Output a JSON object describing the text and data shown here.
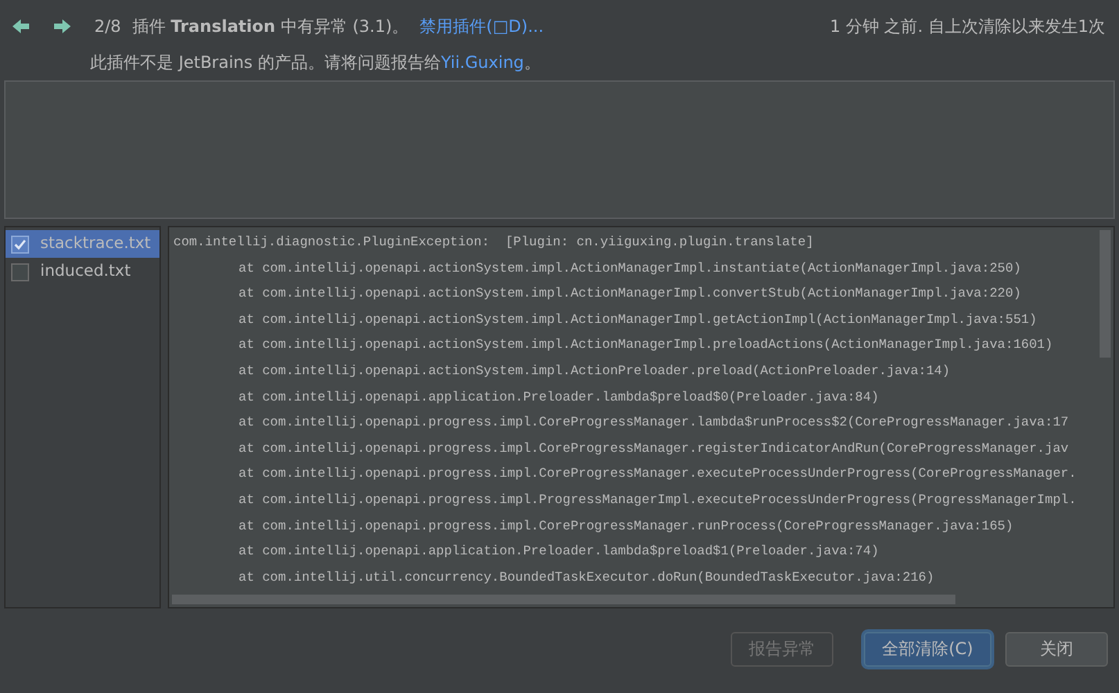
{
  "header": {
    "counter": "2/8",
    "message": "插件 **Translation** 中有异常 (3.1)。",
    "disable_link": "禁用插件(□D)...",
    "time": "1 分钟 之前. 自上次清除以来发生1次",
    "note": "此插件不是 JetBrains 的产品。请将问题报告给",
    "author_link": "Yii.Guxing",
    "note_end": "。"
  },
  "attachments": [
    {
      "name": "stacktrace.txt",
      "checked": true,
      "selected": true
    },
    {
      "name": "induced.txt",
      "checked": false,
      "selected": false
    }
  ],
  "stack_trace": [
    {
      "kind": "exception",
      "text": "com.intellij.diagnostic.PluginException:  [Plugin: cn.yiiguxing.plugin.translate]"
    },
    {
      "kind": "frame",
      "text": "at com.intellij.openapi.actionSystem.impl.ActionManagerImpl.instantiate(ActionManagerImpl.java:250)"
    },
    {
      "kind": "frame",
      "text": "at com.intellij.openapi.actionSystem.impl.ActionManagerImpl.convertStub(ActionManagerImpl.java:220)"
    },
    {
      "kind": "frame",
      "text": "at com.intellij.openapi.actionSystem.impl.ActionManagerImpl.getActionImpl(ActionManagerImpl.java:551)"
    },
    {
      "kind": "frame",
      "text": "at com.intellij.openapi.actionSystem.impl.ActionManagerImpl.preloadActions(ActionManagerImpl.java:1601)"
    },
    {
      "kind": "frame",
      "text": "at com.intellij.openapi.actionSystem.impl.ActionPreloader.preload(ActionPreloader.java:14)"
    },
    {
      "kind": "frame",
      "text": "at com.intellij.openapi.application.Preloader.lambda$preload$0(Preloader.java:84)"
    },
    {
      "kind": "frame",
      "text": "at com.intellij.openapi.progress.impl.CoreProgressManager.lambda$runProcess$2(CoreProgressManager.java:17"
    },
    {
      "kind": "frame",
      "text": "at com.intellij.openapi.progress.impl.CoreProgressManager.registerIndicatorAndRun(CoreProgressManager.jav"
    },
    {
      "kind": "frame",
      "text": "at com.intellij.openapi.progress.impl.CoreProgressManager.executeProcessUnderProgress(CoreProgressManager."
    },
    {
      "kind": "frame",
      "text": "at com.intellij.openapi.progress.impl.ProgressManagerImpl.executeProcessUnderProgress(ProgressManagerImpl."
    },
    {
      "kind": "frame",
      "text": "at com.intellij.openapi.progress.impl.CoreProgressManager.runProcess(CoreProgressManager.java:165)"
    },
    {
      "kind": "frame",
      "text": "at com.intellij.openapi.application.Preloader.lambda$preload$1(Preloader.java:74)"
    },
    {
      "kind": "frame",
      "text": "at com.intellij.util.concurrency.BoundedTaskExecutor.doRun(BoundedTaskExecutor.java:216)"
    }
  ],
  "buttons": [
    {
      "label": "报告异常",
      "disabled": true,
      "default": false
    },
    {
      "label": "全部清除(C)",
      "disabled": false,
      "default": true
    },
    {
      "label": "关闭",
      "disabled": false,
      "default": false
    }
  ]
}
